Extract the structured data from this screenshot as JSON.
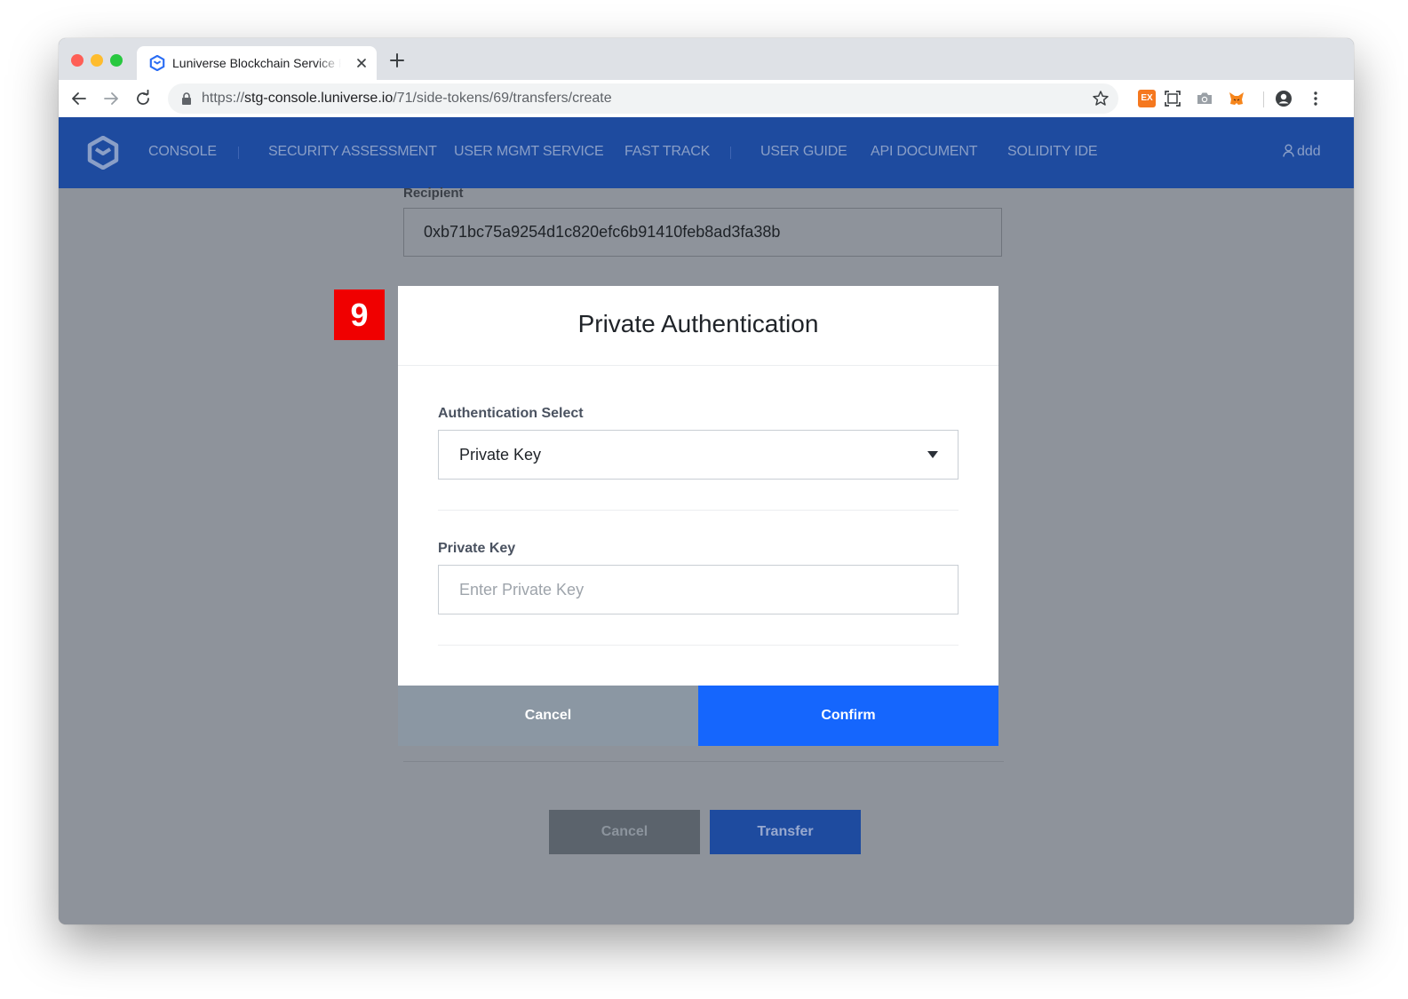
{
  "browser": {
    "tab_title": "Luniverse Blockchain Service P",
    "url_prefix": "https://",
    "url_host": "stg-console.luniverse.io",
    "url_path": "/71/side-tokens/69/transfers/create",
    "extension_label": "EX"
  },
  "nav": {
    "items": [
      "CONSOLE",
      "SECURITY ASSESSMENT",
      "USER MGMT SERVICE",
      "FAST TRACK",
      "USER GUIDE",
      "API DOCUMENT",
      "SOLIDITY IDE"
    ],
    "user": "ddd"
  },
  "form": {
    "recipient_label": "Recipient",
    "recipient_value": "0xb71bc75a9254d1c820efc6b91410feb8ad3fa38b",
    "cancel_label": "Cancel",
    "transfer_label": "Transfer"
  },
  "step_badge": "9",
  "modal": {
    "title": "Private Authentication",
    "auth_select_label": "Authentication Select",
    "auth_select_value": "Private Key",
    "private_key_label": "Private Key",
    "private_key_placeholder": "Enter Private Key",
    "cancel_label": "Cancel",
    "confirm_label": "Confirm"
  },
  "colors": {
    "header_bg": "#1e4b9f",
    "confirm_bg": "#1566fd",
    "cancel_bg": "#8b97a3",
    "overlay_bg": "#8e939b",
    "badge_bg": "#f00000"
  }
}
